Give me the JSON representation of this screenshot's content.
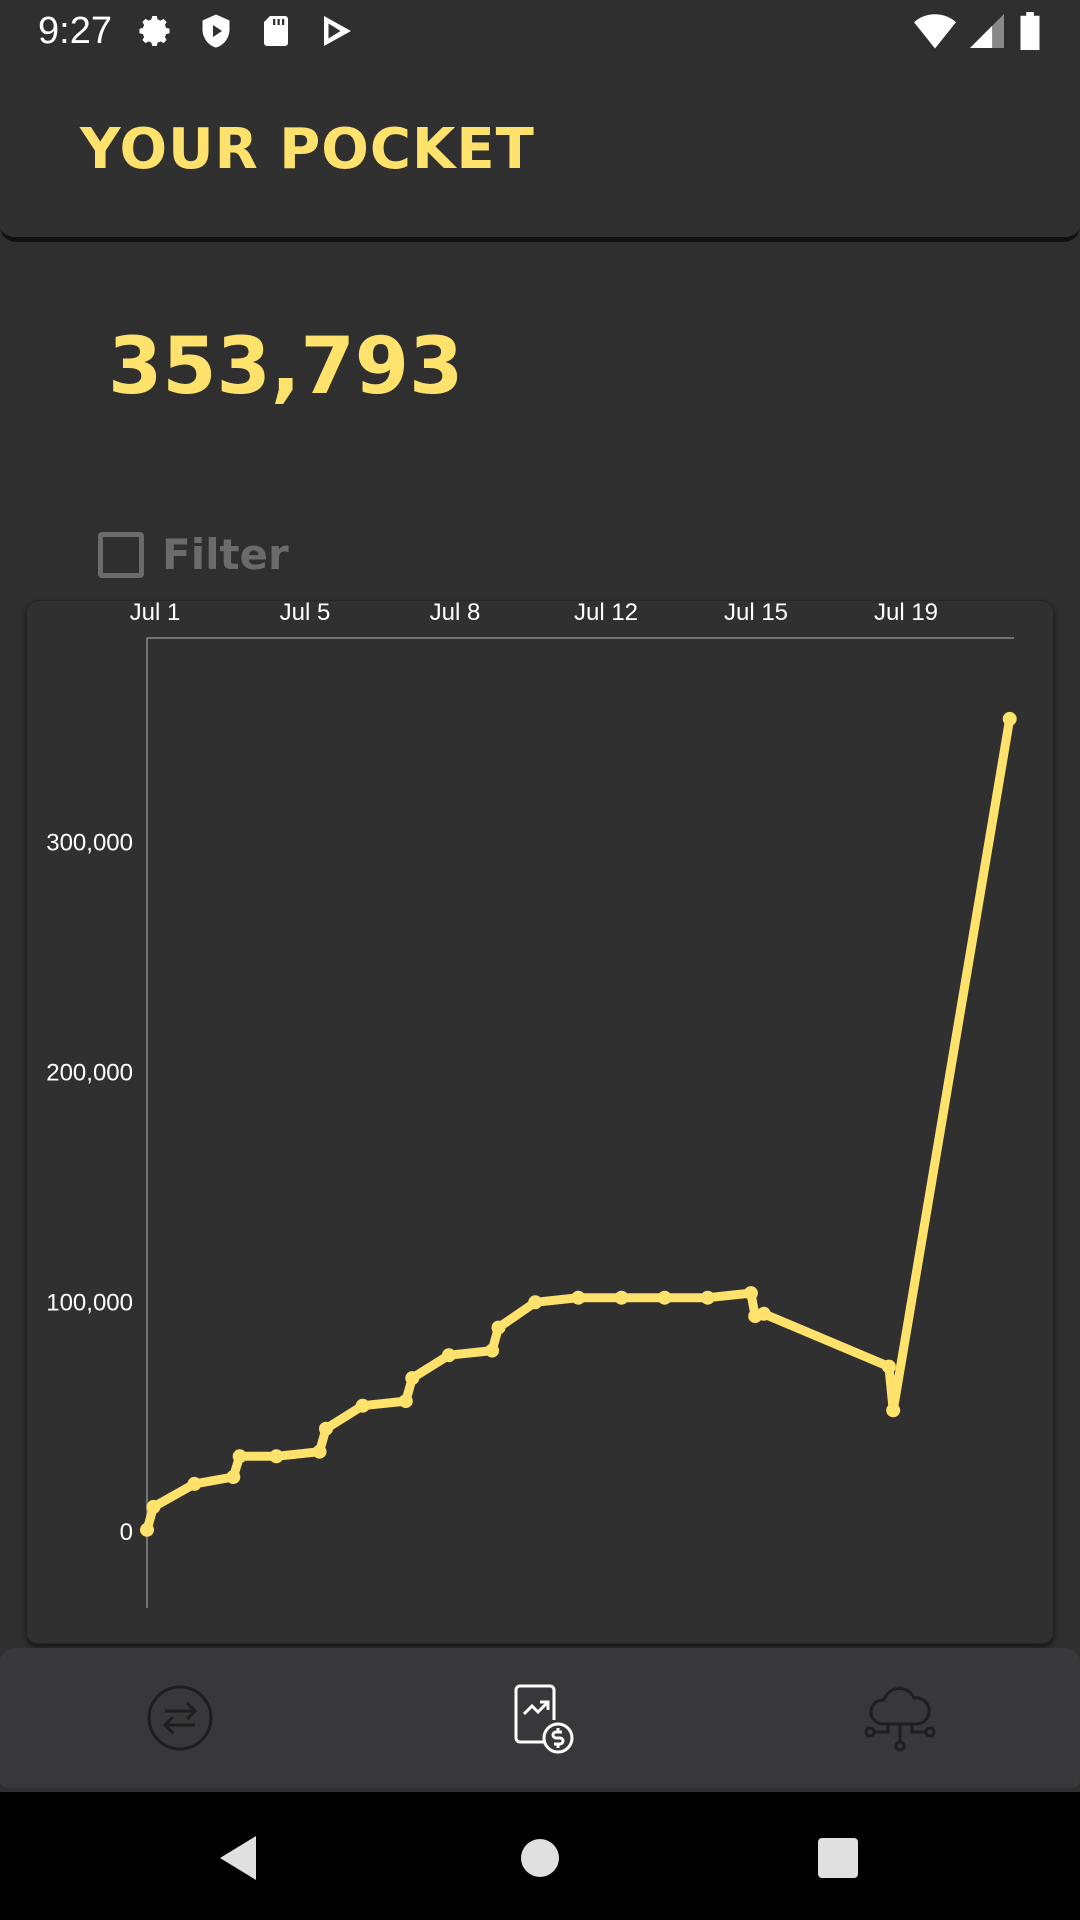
{
  "status_bar": {
    "time": "9:27",
    "left_icons": [
      "gear-icon",
      "shield-icon",
      "sd-card-icon",
      "play-store-icon"
    ],
    "right_icons": [
      "wifi-icon",
      "signal-icon",
      "battery-icon"
    ]
  },
  "app_bar": {
    "title": "YOUR POCKET"
  },
  "balance": {
    "value": "353,793"
  },
  "filter": {
    "label": "Filter",
    "checked": false
  },
  "chart_data": {
    "type": "line",
    "color": "#ffe26b",
    "x_tick_labels": [
      "Jul 1",
      "Jul 5",
      "Jul 8",
      "Jul 12",
      "Jul 15",
      "Jul 19"
    ],
    "y_tick_labels": [
      "0",
      "100,000",
      "200,000",
      "300,000"
    ],
    "y_ticks": [
      0,
      100000,
      200000,
      300000
    ],
    "xlim": [
      0.0,
      20.1
    ],
    "ylim": [
      -33000,
      389000
    ],
    "series": [
      {
        "points": [
          [
            0.0,
            1000
          ],
          [
            0.15,
            11000
          ],
          [
            1.1,
            21000
          ],
          [
            2.0,
            24000
          ],
          [
            2.15,
            33000
          ],
          [
            3.0,
            33000
          ],
          [
            4.0,
            35000
          ],
          [
            4.15,
            45000
          ],
          [
            5.0,
            55000
          ],
          [
            6.0,
            57000
          ],
          [
            6.15,
            67000
          ],
          [
            7.0,
            77000
          ],
          [
            8.0,
            79000
          ],
          [
            8.15,
            89000
          ],
          [
            9.0,
            100000
          ],
          [
            10.0,
            102000
          ],
          [
            11.0,
            102000
          ],
          [
            12.0,
            102000
          ],
          [
            13.0,
            102000
          ],
          [
            14.0,
            104000
          ],
          [
            14.1,
            94000
          ],
          [
            14.3,
            95000
          ],
          [
            17.2,
            72000
          ],
          [
            17.3,
            53000
          ],
          [
            20.0,
            353793
          ]
        ]
      }
    ]
  },
  "bottom_nav": {
    "items": [
      "transfer-icon",
      "statement-money-icon",
      "cloud-network-icon"
    ]
  },
  "system_nav": {
    "buttons": [
      "back-button",
      "home-button",
      "recents-button"
    ]
  }
}
